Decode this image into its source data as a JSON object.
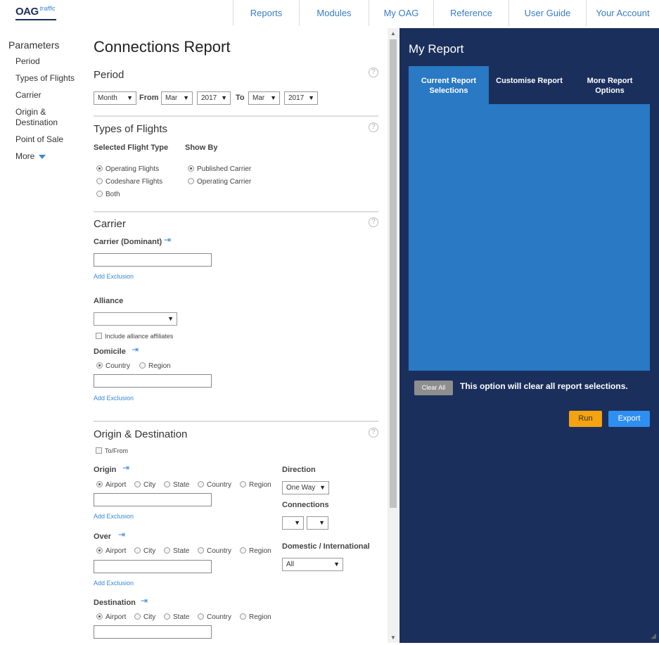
{
  "logo": {
    "mark": "OAG",
    "sub": "traffic"
  },
  "nav": [
    "Reports",
    "Modules",
    "My OAG",
    "Reference",
    "User Guide",
    "Your Account"
  ],
  "params": {
    "title": "Parameters",
    "items": [
      "Period",
      "Types of Flights",
      "Carrier",
      "Origin &\nDestination",
      "Point of Sale",
      "More"
    ]
  },
  "page_title": "Connections Report",
  "period": {
    "title": "Period",
    "granularity": "Month",
    "from_label": "From",
    "from_month": "Mar",
    "from_year": "2017",
    "to_label": "To",
    "to_month": "Mar",
    "to_year": "2017"
  },
  "types": {
    "title": "Types of Flights",
    "selected_label": "Selected Flight Type",
    "showby_label": "Show By",
    "flight_options": [
      "Operating Flights",
      "Codeshare Flights",
      "Both"
    ],
    "showby_options": [
      "Published Carrier",
      "Operating Carrier"
    ]
  },
  "carrier": {
    "title": "Carrier",
    "dominant_label": "Carrier (Dominant)",
    "add_exclusion": "Add Exclusion",
    "alliance_label": "Alliance",
    "alliance_value": "",
    "affiliates_label": "Include alliance affiliates",
    "domicile_label": "Domicile",
    "domicile_options": [
      "Country",
      "Region"
    ],
    "add_exclusion_2": "Add Exclusion"
  },
  "od": {
    "title": "Origin & Destination",
    "tofrom_label": "To/From",
    "origin_label": "Origin",
    "over_label": "Over",
    "destination_label": "Destination",
    "loc_options": [
      "Airport",
      "City",
      "State",
      "Country",
      "Region"
    ],
    "add_exclusion": "Add Exclusion",
    "direction_label": "Direction",
    "direction_value": "One Way",
    "connections_label": "Connections",
    "domint_label": "Domestic / International",
    "domint_value": "All"
  },
  "report": {
    "title": "My Report",
    "tabs": [
      "Current Report\nSelections",
      "Customise Report",
      "More Report\nOptions"
    ],
    "clear_button": "Clear All",
    "clear_message": "This option will clear all report selections.",
    "run_button": "Run",
    "export_button": "Export"
  },
  "colors": {
    "panel": "#1b2f5c",
    "tab_active": "#2979c4",
    "run": "#f5a30f",
    "export": "#2e8ff0"
  }
}
